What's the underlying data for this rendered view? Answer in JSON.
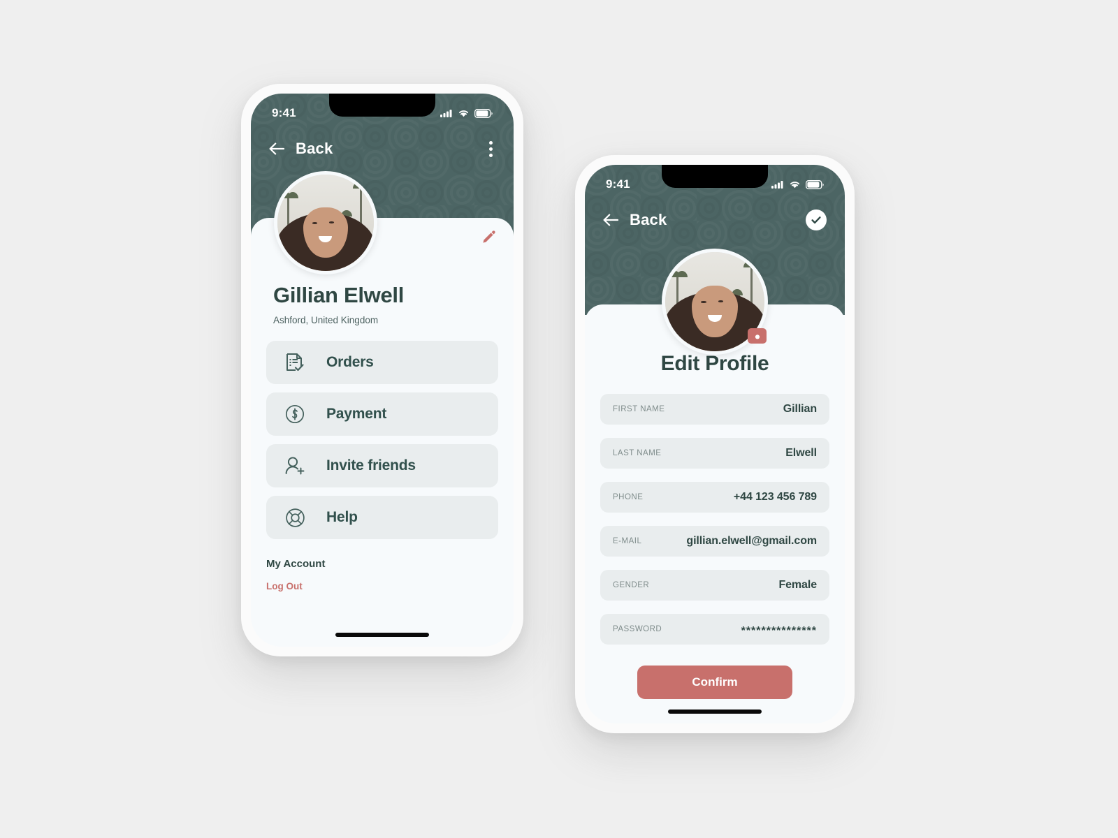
{
  "theme": {
    "header_green": "#4c6564",
    "accent_red": "#c8706c",
    "text_dark": "#2f4743",
    "card_grey": "#e9edee",
    "screen_bg": "#f7fafc",
    "page_bg": "#efefef"
  },
  "profile_screen": {
    "status_bar": {
      "time": "9:41",
      "cellular_icon": "cellular-signal-icon",
      "wifi_icon": "wifi-icon",
      "battery_icon": "battery-icon"
    },
    "nav": {
      "back_icon": "arrow-left-icon",
      "back_label": "Back",
      "overflow_icon": "kebab-menu-icon"
    },
    "avatar_alt": "user-avatar",
    "edit_icon": "pencil-icon",
    "name": "Gillian Elwell",
    "location": "Ashford, United Kingdom",
    "menu": [
      {
        "label": "Orders",
        "icon": "document-check-icon"
      },
      {
        "label": "Payment",
        "icon": "dollar-circle-icon"
      },
      {
        "label": "Invite friends",
        "icon": "user-plus-icon"
      },
      {
        "label": "Help",
        "icon": "lifebuoy-icon"
      }
    ],
    "account_heading": "My Account",
    "logout_label": "Log Out"
  },
  "edit_screen": {
    "status_bar": {
      "time": "9:41",
      "cellular_icon": "cellular-signal-icon",
      "wifi_icon": "wifi-icon",
      "battery_icon": "battery-icon"
    },
    "nav": {
      "back_icon": "arrow-left-icon",
      "back_label": "Back",
      "confirm_icon": "check-circle-icon"
    },
    "avatar_alt": "user-avatar",
    "camera_icon": "camera-icon",
    "title": "Edit Profile",
    "fields": [
      {
        "label": "FIRST NAME",
        "value": "Gillian",
        "name": "first-name"
      },
      {
        "label": "LAST NAME",
        "value": "Elwell",
        "name": "last-name"
      },
      {
        "label": "PHONE",
        "value": "+44 123 456 789",
        "name": "phone"
      },
      {
        "label": "E-MAIL",
        "value": "gillian.elwell@gmail.com",
        "name": "email"
      },
      {
        "label": "GENDER",
        "value": "Female",
        "name": "gender"
      },
      {
        "label": "PASSWORD",
        "value": "***************",
        "name": "password"
      }
    ],
    "confirm_label": "Confirm"
  }
}
